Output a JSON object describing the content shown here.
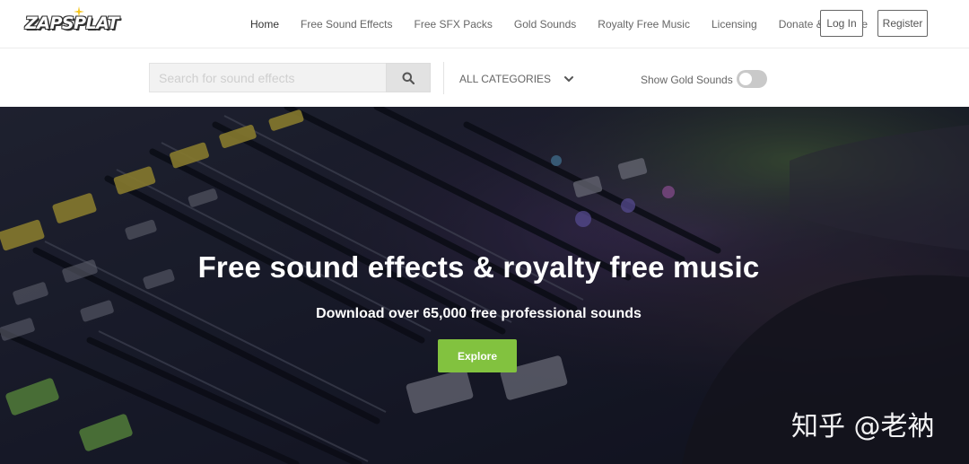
{
  "brand": {
    "logo_text": "ZAPSPLAT"
  },
  "nav": {
    "links": [
      "Home",
      "Free Sound Effects",
      "Free SFX Packs",
      "Gold Sounds",
      "Royalty Free Music",
      "Licensing",
      "Donate & Upgrade"
    ],
    "login_label": "Log In",
    "register_label": "Register"
  },
  "search": {
    "placeholder": "Search for sound effects",
    "search_icon": "search-icon",
    "category_label": "ALL CATEGORIES",
    "category_icon": "chevron-down-icon",
    "gold_toggle_label": "Show Gold Sounds",
    "gold_toggle_on": false
  },
  "hero": {
    "title": "Free sound effects & royalty free music",
    "subtitle": "Download over 65,000 free professional sounds",
    "cta_label": "Explore"
  },
  "watermark": {
    "text": "知乎 @老衲"
  },
  "colors": {
    "accent_green": "#82c23f",
    "nav_text": "#666666",
    "hero_overlay": "#1c1e2a"
  }
}
